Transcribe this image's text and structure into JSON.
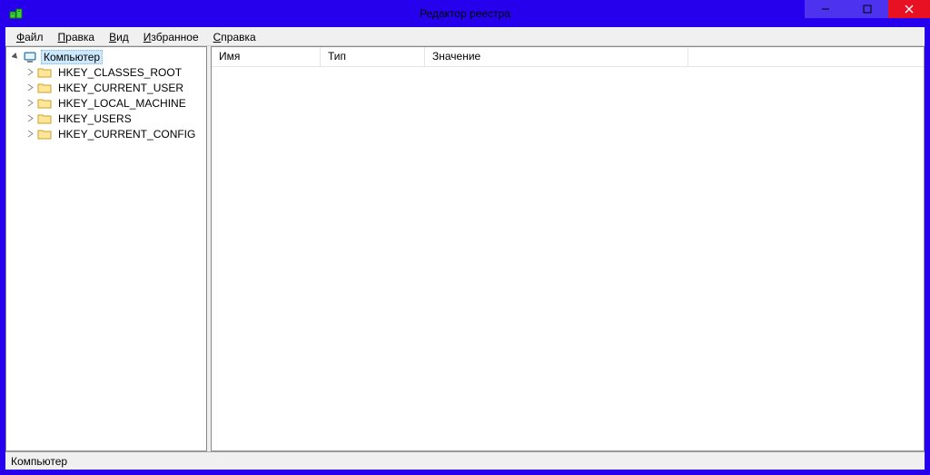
{
  "title": "Редактор реестра",
  "menu": {
    "file": {
      "mn": "Ф",
      "rest": "айл"
    },
    "edit": {
      "mn": "П",
      "rest": "равка"
    },
    "view": {
      "mn": "В",
      "rest": "ид"
    },
    "fav": {
      "mn": "И",
      "rest": "збранное"
    },
    "help": {
      "mn": "С",
      "rest": "правка"
    }
  },
  "tree": {
    "root": {
      "label": "Компьютер",
      "expanded": true,
      "selected": true
    },
    "hives": [
      {
        "label": "HKEY_CLASSES_ROOT"
      },
      {
        "label": "HKEY_CURRENT_USER"
      },
      {
        "label": "HKEY_LOCAL_MACHINE"
      },
      {
        "label": "HKEY_USERS"
      },
      {
        "label": "HKEY_CURRENT_CONFIG"
      }
    ]
  },
  "columns": {
    "name": "Имя",
    "type": "Тип",
    "value": "Значение"
  },
  "statusbar": "Компьютер"
}
